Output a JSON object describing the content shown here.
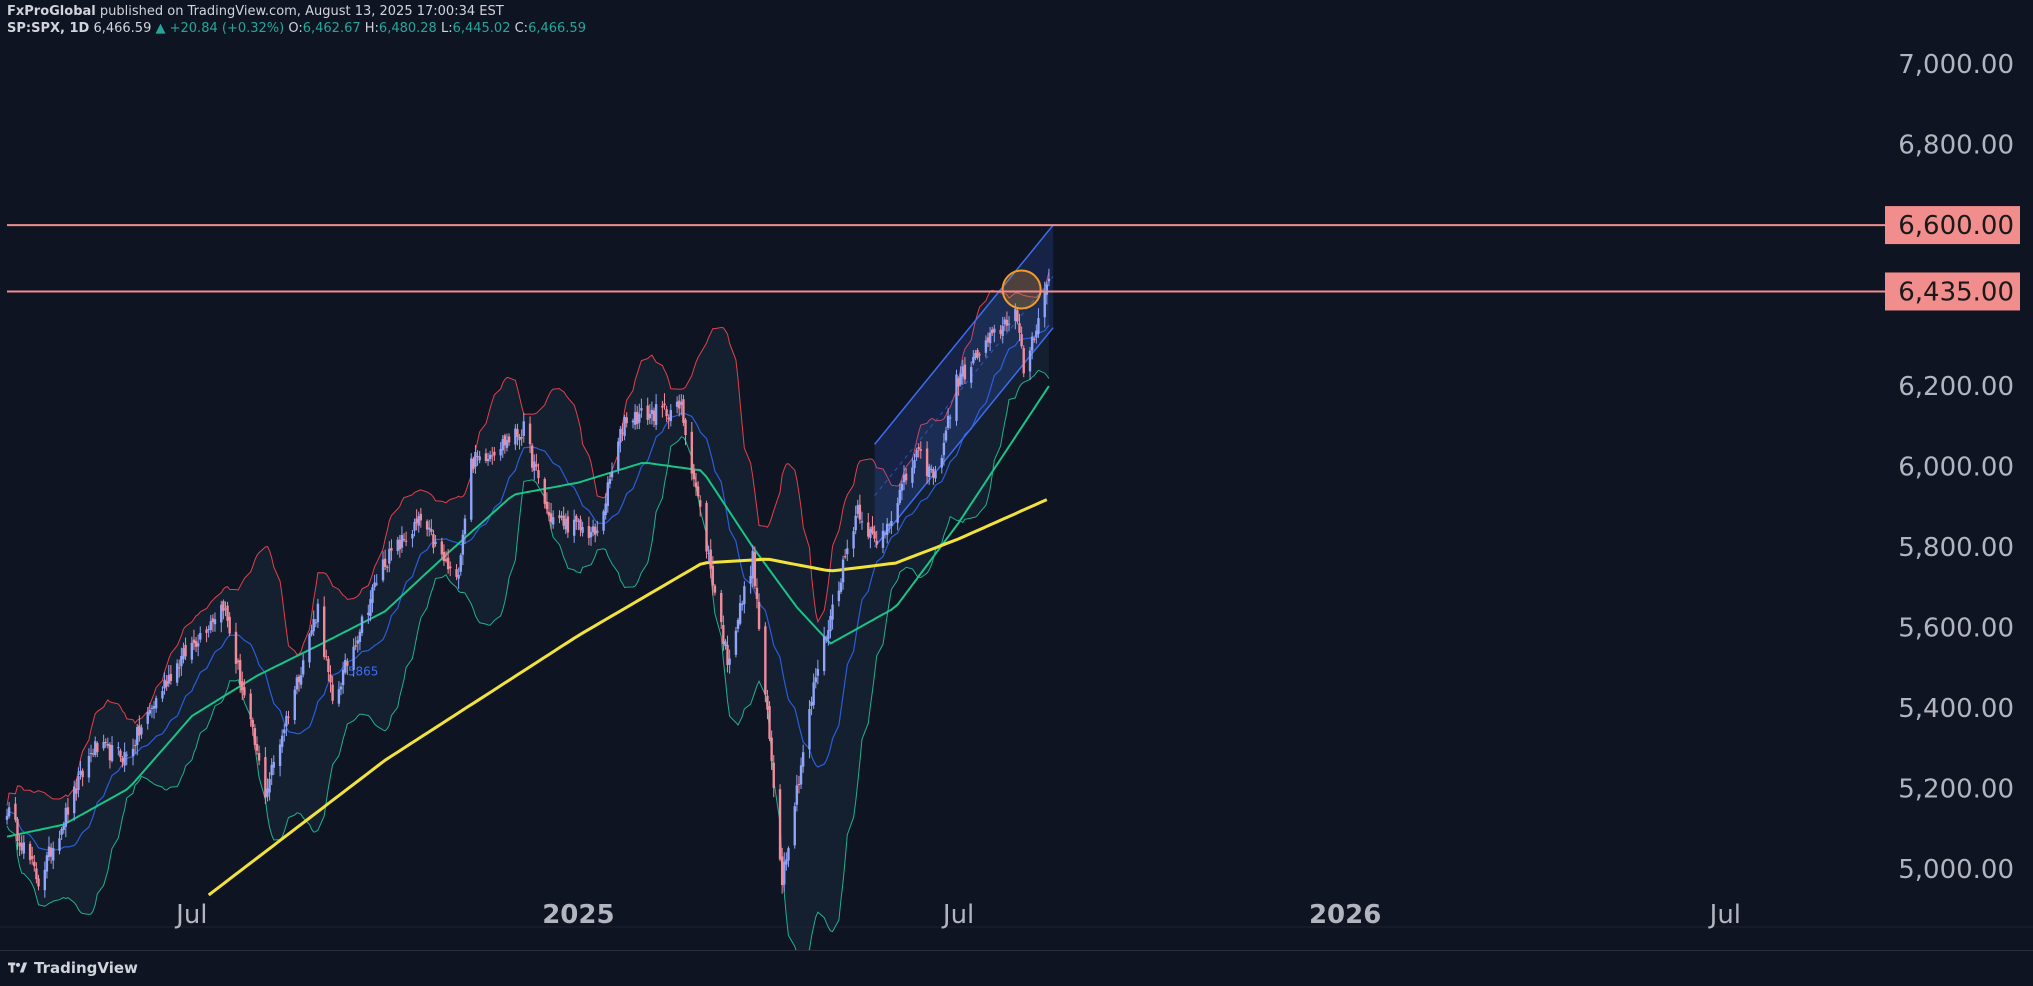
{
  "header": {
    "publisher": "FxProGlobal",
    "published_text": "published on TradingView.com, August 13, 2025 17:00:34 EST",
    "symbol": "SP:SPX, 1D",
    "last_price": "6,466.59",
    "change_arrow": "▲",
    "change": "+20.84 (+0.32%)",
    "open_label": "O:",
    "open": "6,462.67",
    "high_label": "H:",
    "high": "6,480.28",
    "low_label": "L:",
    "low": "6,445.02",
    "close_label": "C:",
    "close": "6,466.59"
  },
  "footer": {
    "brand": "TradingView",
    "logo_icon": "tradingview-logo-icon"
  },
  "colors": {
    "background": "#0f1422",
    "candle_up": "#90a4f8",
    "candle_down": "#f08b9b",
    "bb_upper": "#e0404a",
    "bb_lower": "#1fb08a",
    "bb_basis": "#2a5cd8",
    "ma_mid": "#18c486",
    "ma_long": "#f2e33c",
    "channel": "#3d6cf0",
    "level_line": "#f28d8d",
    "level_label_bg": "#f28d8d",
    "circle": "#f59a23"
  },
  "chart_data": {
    "type": "candlestick",
    "symbol": "SP:SPX",
    "timeframe": "1D",
    "y_axis": {
      "ticks": [
        5000,
        5200,
        5400,
        5600,
        5800,
        6000,
        6200,
        6800,
        7000
      ],
      "tick_labels": [
        "5,000.00",
        "5,200.00",
        "5,400.00",
        "5,600.00",
        "5,800.00",
        "6,000.00",
        "6,200.00",
        "6,800.00",
        "7,000.00"
      ],
      "ylim": [
        4935,
        7060
      ]
    },
    "x_axis": {
      "xlim": [
        "2024-04-04",
        "2026-09-15"
      ],
      "ticks": [
        {
          "date": "2024-07-01",
          "label": "Jul",
          "bold": false
        },
        {
          "date": "2025-01-01",
          "label": "2025",
          "bold": true
        },
        {
          "date": "2025-07-01",
          "label": "Jul",
          "bold": false
        },
        {
          "date": "2026-01-01",
          "label": "2026",
          "bold": true
        },
        {
          "date": "2026-07-01",
          "label": "Jul",
          "bold": false
        }
      ]
    },
    "horizontal_levels": [
      {
        "value": 6600,
        "label": "6,600.00"
      },
      {
        "value": 6435,
        "label": "6,435.00"
      }
    ],
    "annotation_text": "5865",
    "price_anchors": [
      [
        "2024-04-04",
        5150
      ],
      [
        "2024-04-19",
        4970
      ],
      [
        "2024-05-15",
        5300
      ],
      [
        "2024-05-31",
        5280
      ],
      [
        "2024-06-20",
        5480
      ],
      [
        "2024-07-16",
        5660
      ],
      [
        "2024-08-05",
        5190
      ],
      [
        "2024-08-30",
        5650
      ],
      [
        "2024-09-06",
        5410
      ],
      [
        "2024-09-30",
        5760
      ],
      [
        "2024-10-18",
        5865
      ],
      [
        "2024-11-04",
        5710
      ],
      [
        "2024-11-11",
        6010
      ],
      [
        "2024-12-06",
        6090
      ],
      [
        "2024-12-18",
        5875
      ],
      [
        "2025-01-10",
        5830
      ],
      [
        "2025-01-23",
        6120
      ],
      [
        "2025-02-19",
        6145
      ],
      [
        "2025-03-13",
        5520
      ],
      [
        "2025-03-25",
        5770
      ],
      [
        "2025-04-08",
        4980
      ],
      [
        "2025-04-24",
        5480
      ],
      [
        "2025-05-14",
        5900
      ],
      [
        "2025-05-23",
        5800
      ],
      [
        "2025-06-11",
        6030
      ],
      [
        "2025-06-20",
        5970
      ],
      [
        "2025-06-30",
        6210
      ],
      [
        "2025-07-28",
        6390
      ],
      [
        "2025-08-01",
        6240
      ],
      [
        "2025-08-13",
        6466
      ]
    ],
    "ma200_anchors": [
      [
        "2024-07-09",
        4935
      ],
      [
        "2024-10-01",
        5270
      ],
      [
        "2025-01-01",
        5580
      ],
      [
        "2025-03-01",
        5760
      ],
      [
        "2025-04-01",
        5770
      ],
      [
        "2025-05-01",
        5740
      ],
      [
        "2025-06-01",
        5760
      ],
      [
        "2025-07-01",
        5820
      ],
      [
        "2025-08-13",
        5920
      ]
    ],
    "ma50_anchors": [
      [
        "2024-04-04",
        5080
      ],
      [
        "2024-05-01",
        5110
      ],
      [
        "2024-06-01",
        5200
      ],
      [
        "2024-07-01",
        5380
      ],
      [
        "2024-08-01",
        5480
      ],
      [
        "2024-09-01",
        5560
      ],
      [
        "2024-10-01",
        5640
      ],
      [
        "2024-11-01",
        5790
      ],
      [
        "2024-12-01",
        5930
      ],
      [
        "2025-01-01",
        5960
      ],
      [
        "2025-02-01",
        6010
      ],
      [
        "2025-03-01",
        5990
      ],
      [
        "2025-03-25",
        5800
      ],
      [
        "2025-04-15",
        5650
      ],
      [
        "2025-05-01",
        5560
      ],
      [
        "2025-06-01",
        5650
      ],
      [
        "2025-07-01",
        5860
      ],
      [
        "2025-08-13",
        6200
      ]
    ],
    "channel": {
      "start": [
        "2025-05-22",
        5800
      ],
      "end": [
        "2025-08-15",
        6600
      ],
      "width": 255
    },
    "circle_center": [
      "2025-07-31",
      6440
    ]
  }
}
